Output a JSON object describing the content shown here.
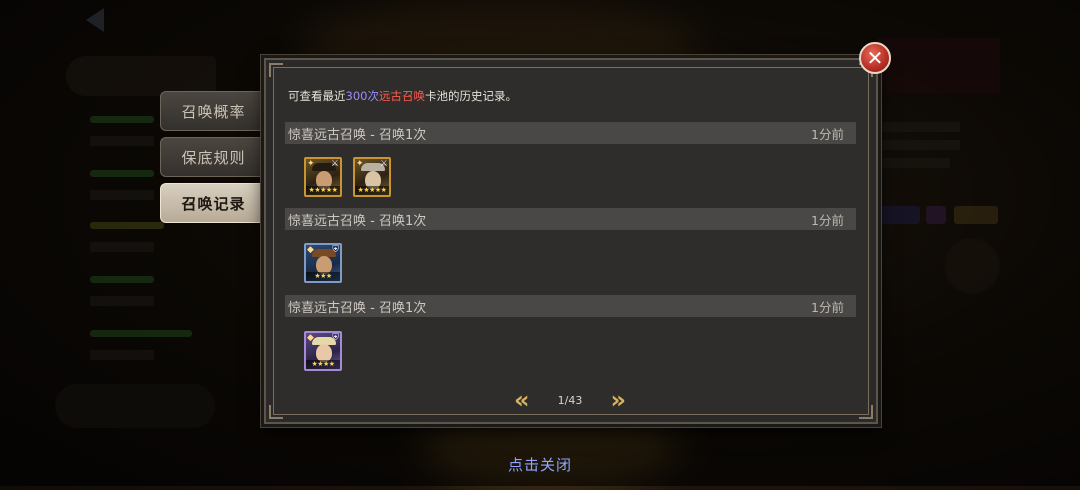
{
  "side_tabs": [
    {
      "label": "召唤概率",
      "active": false
    },
    {
      "label": "保底规则",
      "active": false
    },
    {
      "label": "召唤记录",
      "active": true
    }
  ],
  "description": {
    "prefix": "可查看最近",
    "count": "300次",
    "pool": "远古召唤",
    "suffix": "卡池的历史记录。"
  },
  "records": [
    {
      "title": "惊喜远古召唤 - 召唤1次",
      "time": "1分前",
      "heroes": [
        "gold",
        "gold"
      ]
    },
    {
      "title": "惊喜远古召唤 - 召唤1次",
      "time": "1分前",
      "heroes": [
        "blue"
      ]
    },
    {
      "title": "惊喜远古召唤 - 召唤1次",
      "time": "1分前",
      "heroes": [
        "purple"
      ]
    }
  ],
  "pagination": {
    "page": "1/43",
    "prev_icon": "double-chevron-left",
    "next_icon": "double-chevron-right"
  },
  "close_icon": "close-x",
  "tap_to_close": "点击关闭",
  "colors": {
    "count": "#9d8cff",
    "pool": "#ff5b4d",
    "close_button": "#c23a2e",
    "tap_to_close": "#8fa6ff"
  }
}
